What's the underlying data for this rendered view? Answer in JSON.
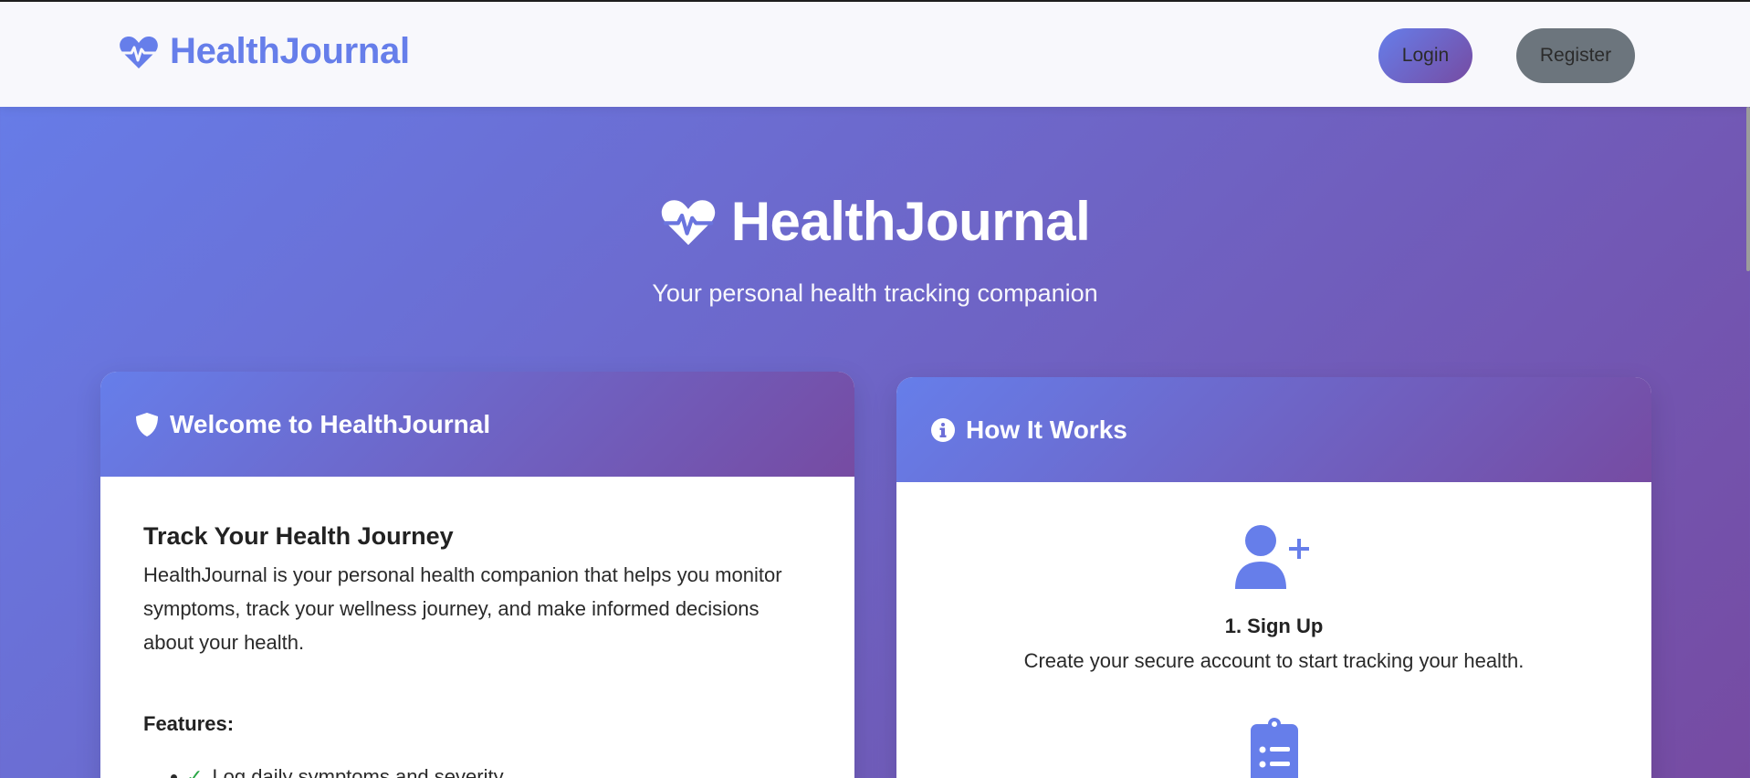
{
  "navbar": {
    "brand": "HealthJournal",
    "brand_icon": "heartbeat-icon",
    "login_label": "Login",
    "register_label": "Register"
  },
  "hero": {
    "title": "HealthJournal",
    "icon": "heartbeat-icon",
    "subtitle": "Your personal health tracking companion"
  },
  "welcome_card": {
    "icon": "shield-icon",
    "title": "Welcome to HealthJournal",
    "heading": "Track Your Health Journey",
    "paragraph": "HealthJournal is your personal health companion that helps you monitor symptoms, track your wellness journey, and make informed decisions about your health.",
    "features_label": "Features:",
    "features": [
      "Log daily symptoms and severity"
    ]
  },
  "how_card": {
    "icon": "info-circle-icon",
    "title": "How It Works",
    "steps": [
      {
        "icon": "user-plus-icon",
        "title": "1. Sign Up",
        "desc": "Create your secure account to start tracking your health."
      },
      {
        "icon": "clipboard-list-icon"
      }
    ]
  },
  "colors": {
    "accent_start": "#667eea",
    "accent_end": "#764ba2",
    "register_gray": "#6c757d",
    "check_green": "#28a745"
  }
}
